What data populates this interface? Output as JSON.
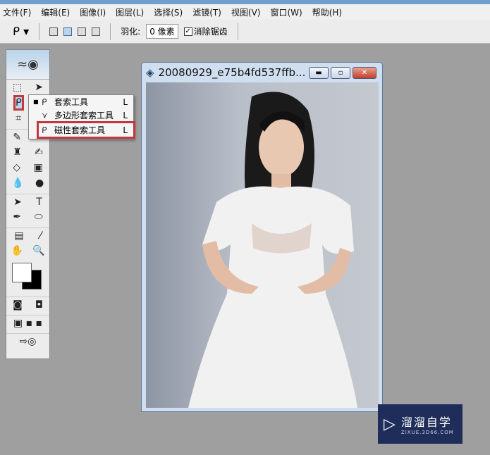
{
  "menu": [
    "文件(F)",
    "编辑(E)",
    "图像(I)",
    "图层(L)",
    "选择(S)",
    "滤镜(T)",
    "视图(V)",
    "窗口(W)",
    "帮助(H)"
  ],
  "options": {
    "feather_label": "羽化:",
    "feather_value": "0 像素",
    "antialias_label": "消除锯齿",
    "antialias_checked": true
  },
  "flyout": [
    {
      "label": "套索工具",
      "key": "L",
      "active": true
    },
    {
      "label": "多边形套索工具",
      "key": "L"
    },
    {
      "label": "磁性套索工具",
      "key": "L",
      "highlighted": true
    }
  ],
  "document": {
    "title": "20080929_e75b4fd537ffb..."
  },
  "watermark": {
    "name": "溜溜自学",
    "url": "ZIXUE.3D66.COM"
  },
  "colors": {
    "highlight": "#c4373f",
    "logo_bg": "#1f2d5a"
  }
}
